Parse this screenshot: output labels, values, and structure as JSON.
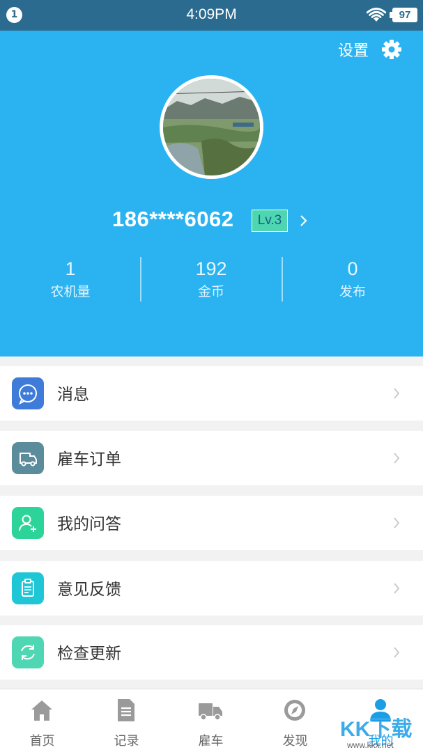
{
  "statusbar": {
    "notification_count": "1",
    "time": "4:09PM",
    "battery": "97"
  },
  "header": {
    "settings_label": "设置",
    "settings_icon": "gear-icon",
    "avatar": "landscape-photo",
    "username": "186****6062",
    "level": "Lv.3"
  },
  "stats": [
    {
      "value": "1",
      "label": "农机量"
    },
    {
      "value": "192",
      "label": "金币"
    },
    {
      "value": "0",
      "label": "发布"
    }
  ],
  "menu": [
    {
      "label": "消息",
      "icon": "chat-bubble-icon",
      "color": "#3f7bd9"
    },
    {
      "label": "雇车订单",
      "icon": "truck-icon",
      "color": "#5b8c9c"
    },
    {
      "label": "我的问答",
      "icon": "user-add-icon",
      "color": "#2cd49a"
    },
    {
      "label": "意见反馈",
      "icon": "clipboard-icon",
      "color": "#1ec6d6"
    },
    {
      "label": "检查更新",
      "icon": "refresh-icon",
      "color": "#4fd6b3"
    }
  ],
  "bottomnav": [
    {
      "label": "首页",
      "icon": "home-icon"
    },
    {
      "label": "记录",
      "icon": "document-icon"
    },
    {
      "label": "雇车",
      "icon": "truck-icon"
    },
    {
      "label": "发现",
      "icon": "compass-icon"
    },
    {
      "label": "我的",
      "icon": "person-icon",
      "active": true
    }
  ],
  "watermark": {
    "brand": "KK下载",
    "url": "www.kkx.net"
  },
  "colors": {
    "statusbar": "#2b6b8f",
    "header": "#2ab3f0",
    "active": "#1a9ee6"
  }
}
